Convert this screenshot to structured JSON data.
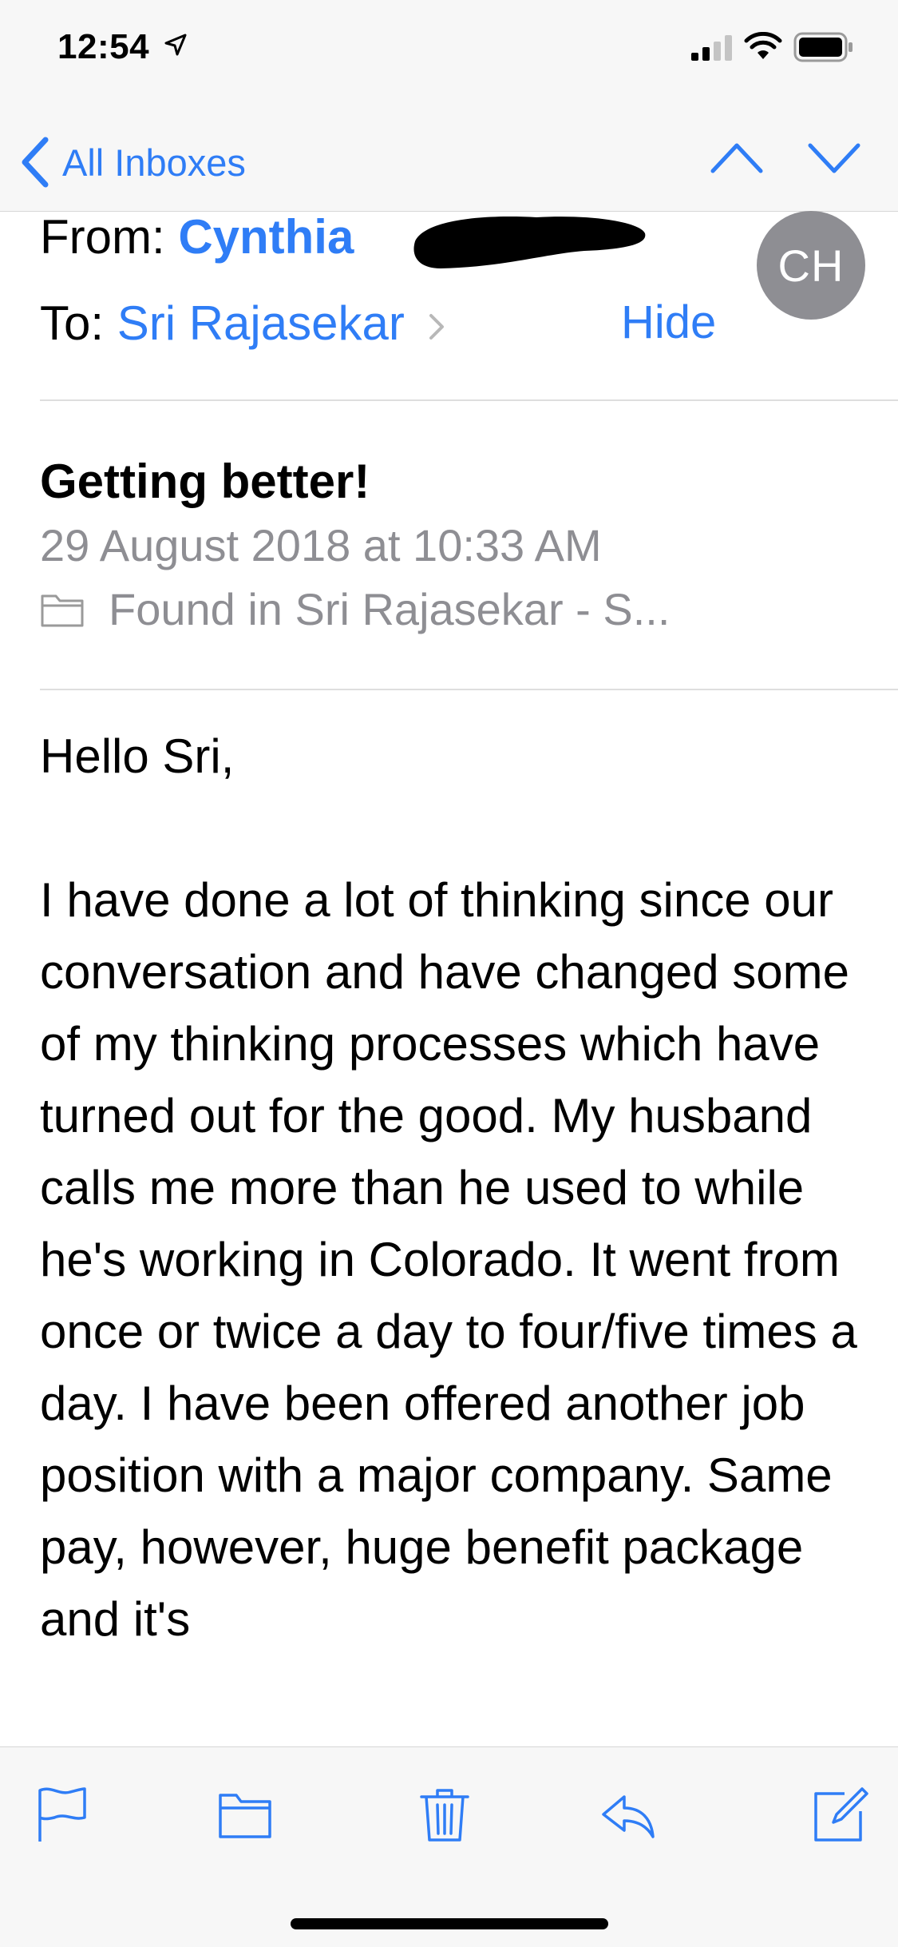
{
  "status_bar": {
    "time": "12:54",
    "icons": [
      "location-arrow-icon",
      "cellular-signal-icon",
      "wifi-icon",
      "battery-icon"
    ]
  },
  "nav": {
    "back_label": "All Inboxes",
    "icons": [
      "chevron-left-icon",
      "chevron-up-icon",
      "chevron-down-icon"
    ]
  },
  "header": {
    "from_label": "From:",
    "from_name": "Cynthia",
    "to_label": "To:",
    "to_name": "Sri Rajasekar",
    "hide_label": "Hide",
    "avatar_initials": "CH"
  },
  "message": {
    "subject": "Getting better!",
    "date": "29 August 2018 at 10:33 AM",
    "folder": "Found in Sri Rajasekar - S...",
    "greeting": "Hello Sri,",
    "body": "I have done a lot of thinking since our conversation and have changed some of my thinking processes which have turned out for the good. My husband calls me more than he used to while he's working in Colorado. It went from once or twice a day to four/five times a day. I have been offered another job position with a major company. Same pay, however, huge benefit package and it's"
  },
  "toolbar": {
    "icons": [
      "flag-icon",
      "folder-icon",
      "trash-icon",
      "reply-icon",
      "compose-icon"
    ]
  },
  "colors": {
    "accent": "#2f7df6",
    "secondary_text": "#8e8e93",
    "bar_background": "#f7f7f7",
    "avatar_background": "#8e8e93"
  }
}
